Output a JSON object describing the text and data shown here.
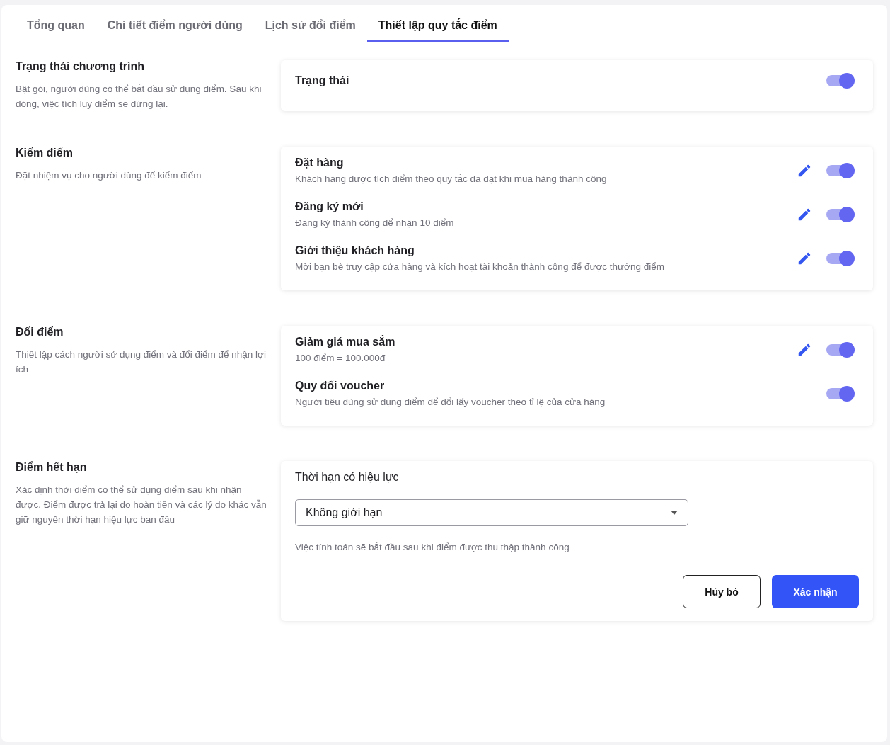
{
  "tabs": [
    {
      "label": "Tổng quan",
      "selected": false
    },
    {
      "label": "Chi tiết điểm người dùng",
      "selected": false
    },
    {
      "label": "Lịch sử đổi điểm",
      "selected": false
    },
    {
      "label": "Thiết lập quy tắc điểm",
      "selected": true
    }
  ],
  "sections": [
    {
      "title": "Trạng thái chương trình",
      "description": "Bật gói, người dùng có thể bắt đầu sử dụng điểm. Sau khi đóng, việc tích lũy điểm sẽ dừng lại.",
      "card": {
        "kind": "status",
        "label": "Trạng thái",
        "on": true
      }
    },
    {
      "title": "Kiếm điểm",
      "description": "Đặt nhiệm vụ cho người dùng để kiếm điểm",
      "card": {
        "kind": "rules",
        "rules": [
          {
            "title": "Đặt hàng",
            "description": "Khách hàng được tích điểm theo quy tắc đã đặt khi mua hàng thành công",
            "editable": true,
            "on": true
          },
          {
            "title": "Đăng ký mới",
            "description": "Đăng ký thành công để nhận 10 điểm",
            "editable": true,
            "on": true
          },
          {
            "title": "Giới thiệu khách hàng",
            "description": "Mời bạn bè truy cập cửa hàng và kích hoạt tài khoản thành công để được thưởng điểm",
            "editable": true,
            "on": true
          }
        ]
      }
    },
    {
      "title": "Đổi điểm",
      "description": "Thiết lập cách người sử dụng điểm và đổi điểm để nhận lợi ích",
      "card": {
        "kind": "rules",
        "rules": [
          {
            "title": "Giảm giá mua sắm",
            "description": "100 điểm = 100.000đ",
            "editable": true,
            "on": true
          },
          {
            "title": "Quy đổi voucher",
            "description": "Người tiêu dùng sử dụng điểm để đổi lấy voucher theo tỉ lệ của cửa hàng",
            "editable": false,
            "on": true
          }
        ]
      }
    },
    {
      "title": "Điểm hết hạn",
      "description": "Xác định thời điểm có thể sử dụng điểm sau khi nhận được. Điểm được trả lại do hoàn tiền và các lý do khác vẫn giữ nguyên thời hạn hiệu lực ban đầu",
      "card": {
        "kind": "expiry",
        "label": "Thời hạn có hiệu lực",
        "value": "Không giới hạn",
        "note": "Việc tính toán sẽ bắt đầu sau khi điểm được thu thập thành công",
        "cancel": "Hủy bỏ",
        "confirm": "Xác nhận"
      }
    }
  ]
}
